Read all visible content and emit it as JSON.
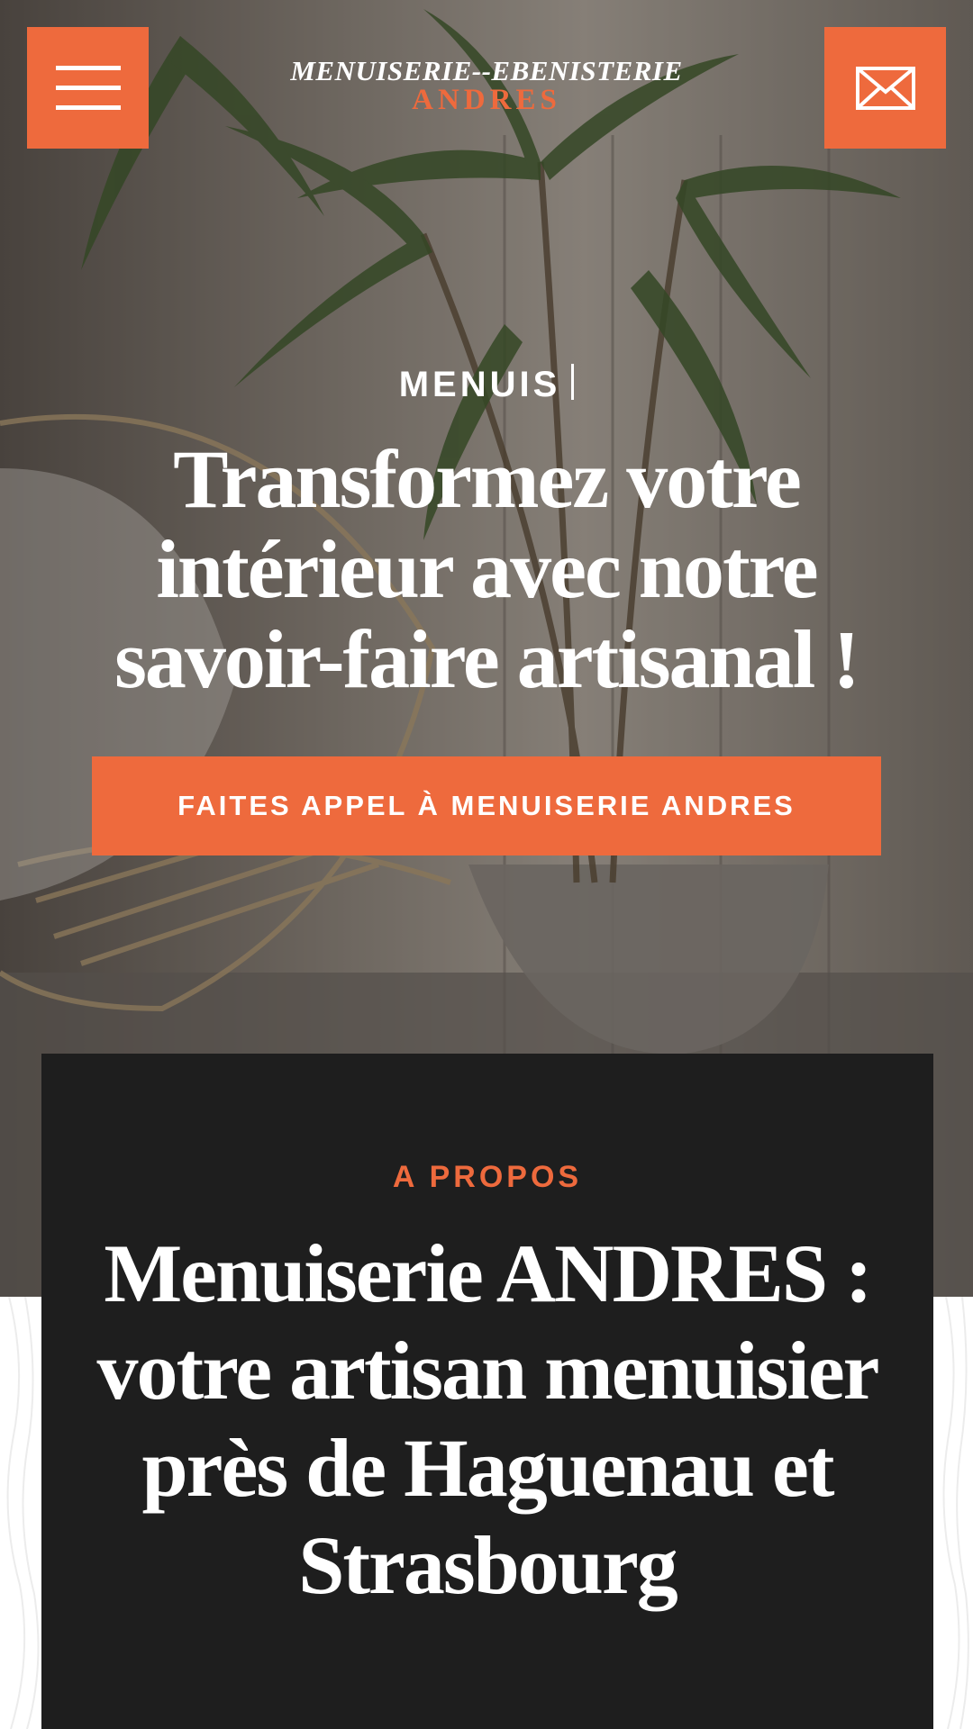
{
  "header": {
    "logo_line1": "MENUISERIE--EBENISTERIE",
    "logo_line2": "ANDRES",
    "menu_icon": "hamburger-menu-icon",
    "mail_icon": "envelope-icon"
  },
  "hero": {
    "typed_text": "MENUIS",
    "title": "Transformez votre intérieur avec notre savoir-faire artisanal !",
    "cta_label": "FAITES APPEL À MENUISERIE ANDRES"
  },
  "about": {
    "kicker": "A PROPOS",
    "title": "Menuiserie ANDRES : votre artisan menuisier près de Haguenau et Strasbourg"
  },
  "colors": {
    "accent": "#ee6a3d",
    "dark_card": "#1e1e1e",
    "text_light": "#ffffff"
  }
}
